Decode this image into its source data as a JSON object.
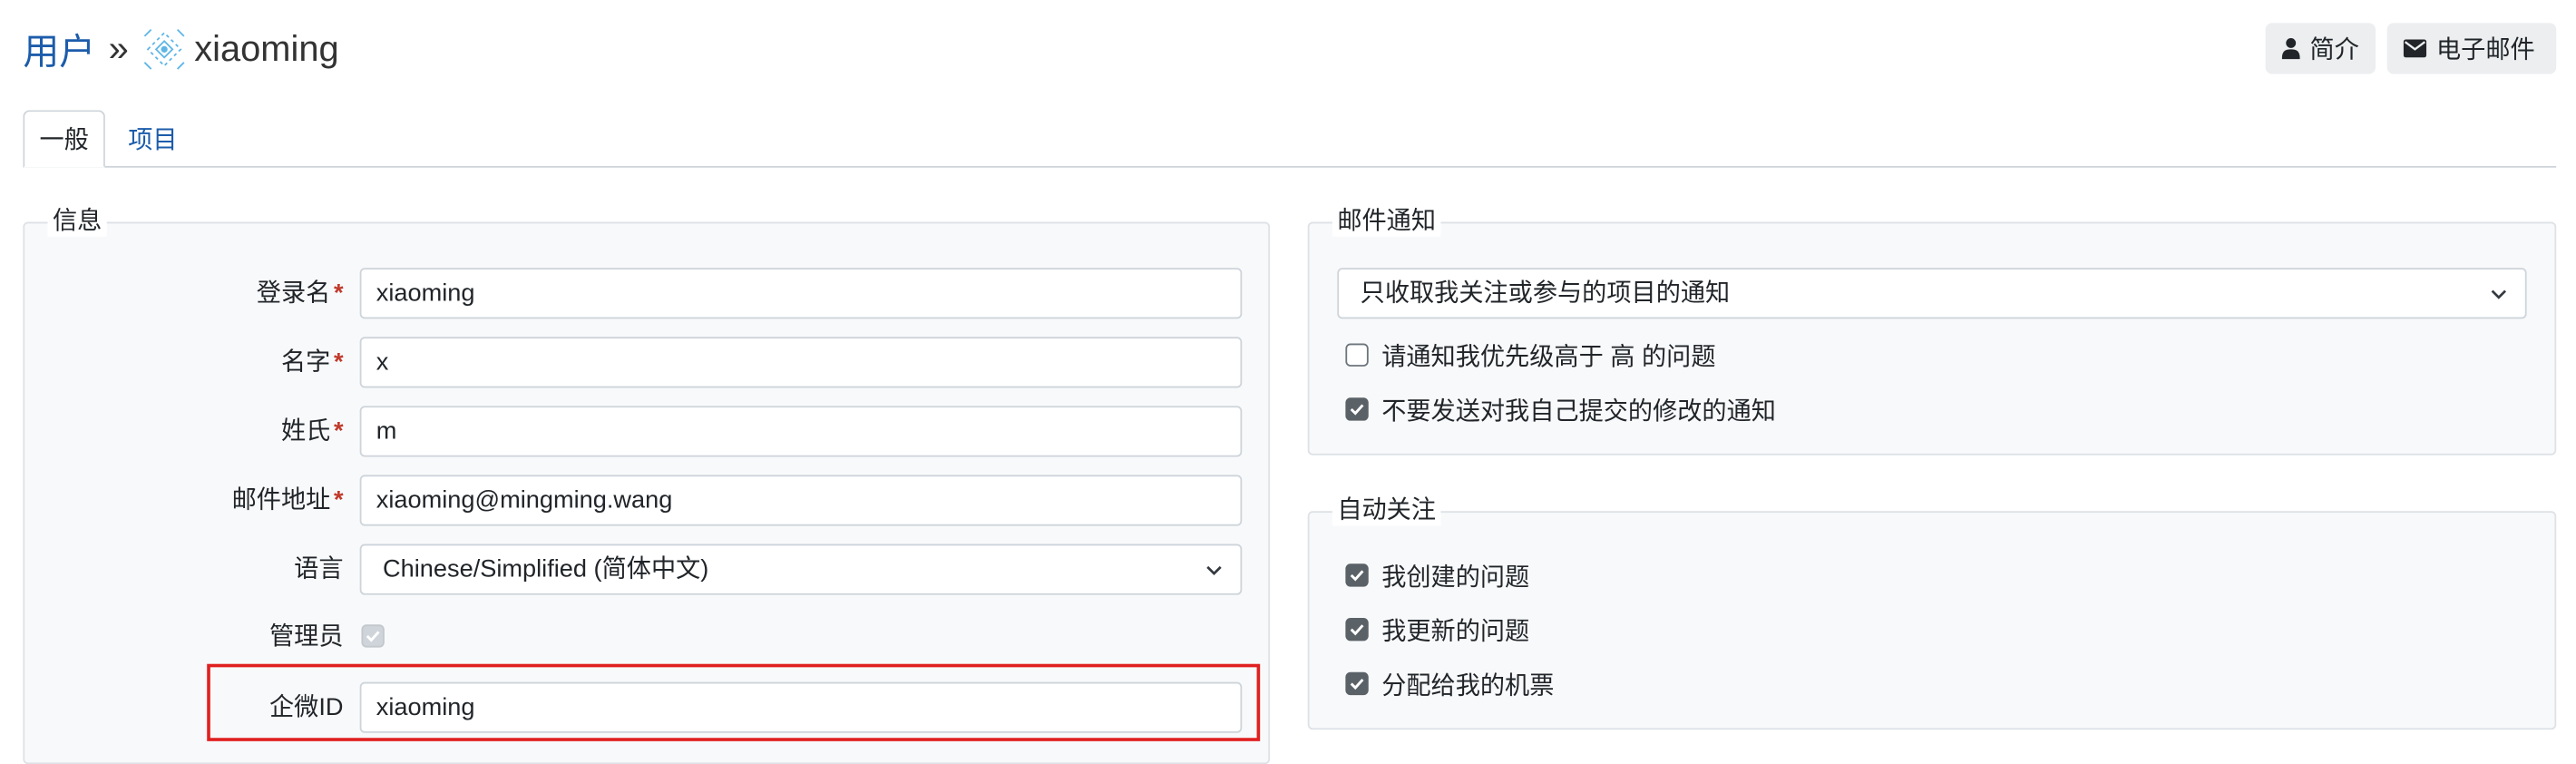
{
  "breadcrumb": {
    "parent": "用户",
    "separator": "»",
    "username": "xiaoming"
  },
  "header_buttons": {
    "profile": "简介",
    "email": "电子邮件"
  },
  "tabs": [
    {
      "label": "一般",
      "active": true
    },
    {
      "label": "项目",
      "active": false
    }
  ],
  "info": {
    "legend": "信息",
    "fields": {
      "login": {
        "label": "登录名",
        "value": "xiaoming",
        "required": "*"
      },
      "firstname": {
        "label": "名字",
        "value": "x",
        "required": "*"
      },
      "lastname": {
        "label": "姓氏",
        "value": "m",
        "required": "*"
      },
      "email": {
        "label": "邮件地址",
        "value": "xiaoming@mingming.wang",
        "required": "*"
      },
      "language": {
        "label": "语言",
        "value": "Chinese/Simplified (简体中文)"
      },
      "admin": {
        "label": "管理员",
        "checked": true,
        "disabled": true
      },
      "wecom": {
        "label": "企微ID",
        "value": "xiaoming"
      }
    }
  },
  "mail_notification": {
    "legend": "邮件通知",
    "selected": "只收取我关注或参与的项目的通知",
    "options": [
      {
        "label": "请通知我优先级高于 高 的问题",
        "checked": false
      },
      {
        "label": "不要发送对我自己提交的修改的通知",
        "checked": true
      }
    ]
  },
  "auto_watch": {
    "legend": "自动关注",
    "options": [
      {
        "label": "我创建的问题",
        "checked": true
      },
      {
        "label": "我更新的问题",
        "checked": true
      },
      {
        "label": "分配给我的机票",
        "checked": true
      }
    ]
  },
  "colors": {
    "link": "#1c5cab",
    "highlight": "#e02020",
    "required": "#c0392b"
  }
}
